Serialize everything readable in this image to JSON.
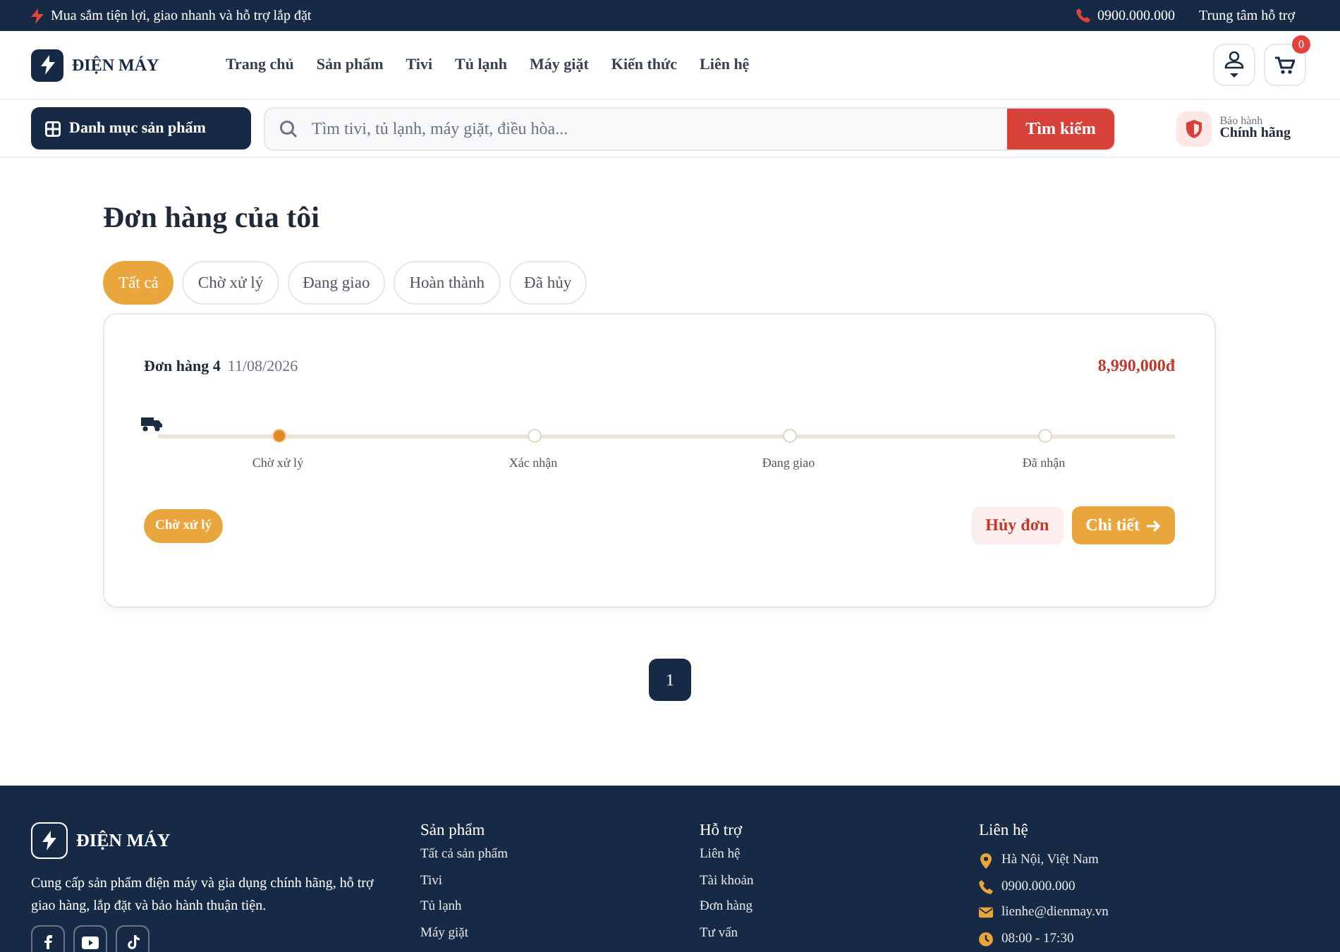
{
  "topbar": {
    "promo": "Mua sắm tiện lợi, giao nhanh và hỗ trợ lắp đặt",
    "phone": "0900.000.000",
    "support": "Trung tâm hỗ trợ"
  },
  "header": {
    "logo": "ĐIỆN MÁY",
    "nav": [
      "Trang chủ",
      "Sản phẩm",
      "Tivi",
      "Tủ lạnh",
      "Máy giặt",
      "Kiến thức",
      "Liên hệ"
    ],
    "cart_count": "0"
  },
  "searchbar": {
    "category_button": "Danh mục sản phẩm",
    "placeholder": "Tìm tivi, tủ lạnh, máy giặt, điều hòa...",
    "search_button": "Tìm kiếm",
    "warranty_caption": "Bảo hành",
    "warranty_title": "Chính hãng"
  },
  "page_title": "Đơn hàng của tôi",
  "tabs": [
    {
      "label": "Tất cả",
      "selected": true
    },
    {
      "label": "Chờ xử lý",
      "selected": false
    },
    {
      "label": "Đang giao",
      "selected": false
    },
    {
      "label": "Hoàn thành",
      "selected": false
    },
    {
      "label": "Đã hủy",
      "selected": false
    }
  ],
  "orders": [
    {
      "title": "Đơn hàng 4",
      "date": "11/08/2026",
      "total": "8,990,000đ",
      "status": "Chờ xử lý",
      "steps": [
        {
          "label": "Chờ xử lý",
          "selected": true
        },
        {
          "label": "Xác nhận",
          "selected": false
        },
        {
          "label": "Đang giao",
          "selected": false
        },
        {
          "label": "Đã nhận",
          "selected": false
        }
      ],
      "cancel_button": "Hủy đơn",
      "detail_button": "Chi tiết"
    }
  ],
  "pagination": [
    {
      "label": "1",
      "selected": true
    }
  ],
  "footer": {
    "logo": "ĐIỆN MÁY",
    "about": "Cung cấp sản phẩm điện máy và gia dụng chính hãng, hỗ trợ giao hàng, lắp đặt và bảo hành thuận tiện.",
    "columns": [
      {
        "title": "Sản phẩm",
        "links": [
          "Tất cả sản phẩm",
          "Tivi",
          "Tủ lạnh",
          "Máy giặt"
        ]
      },
      {
        "title": "Hỗ trợ",
        "links": [
          "Liên hệ",
          "Tài khoản",
          "Đơn hàng",
          "Tư vấn"
        ]
      }
    ],
    "contact_title": "Liên hệ",
    "contacts": [
      {
        "kind": "location",
        "text": "Hà Nội, Việt Nam"
      },
      {
        "kind": "phone",
        "text": "0900.000.000"
      },
      {
        "kind": "mail",
        "text": "lienhe@dienmay.vn"
      },
      {
        "kind": "clock",
        "text": "08:00 - 17:30"
      }
    ]
  }
}
